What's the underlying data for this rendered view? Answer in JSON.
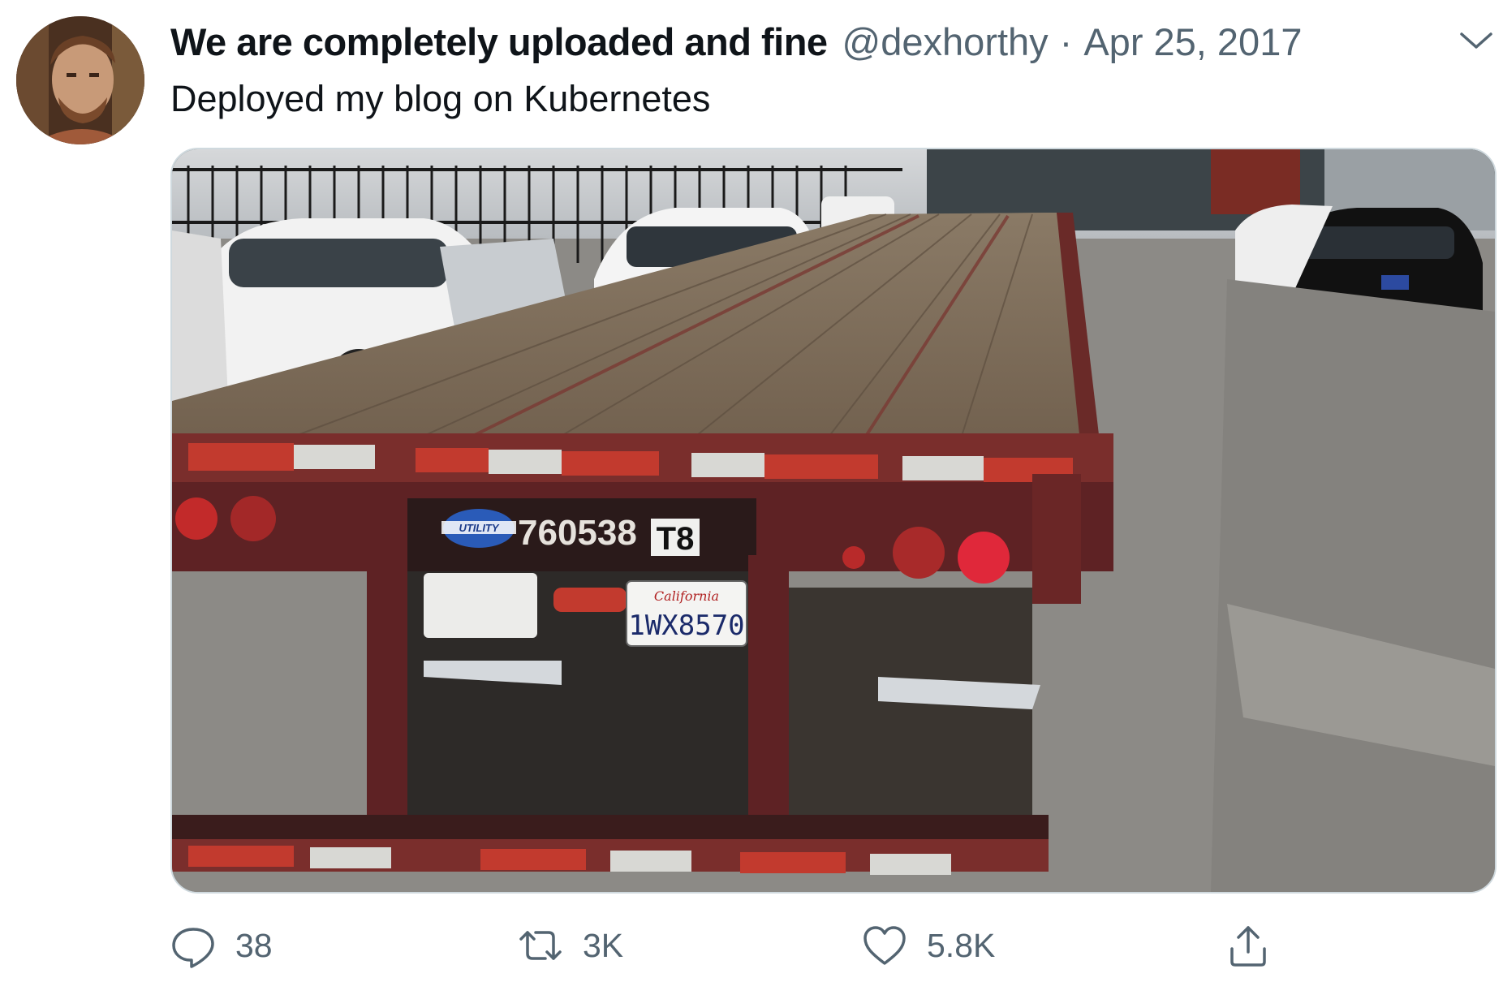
{
  "tweet": {
    "display_name": "We are completely uploaded and fine",
    "handle": "@dexhorthy",
    "separator": "·",
    "date": "Apr 25, 2017",
    "text": "Deployed my blog on Kubernetes"
  },
  "media": {
    "trailer_number": "760538",
    "trailer_code": "T8",
    "logo_text": "UTILITY",
    "plate_state": "California",
    "plate_number": "1WX8570"
  },
  "actions": {
    "reply_count": "38",
    "retweet_count": "3K",
    "like_count": "5.8K"
  },
  "icons": {
    "menu": "chevron-down-icon",
    "reply": "reply-icon",
    "retweet": "retweet-icon",
    "like": "heart-icon",
    "share": "share-icon"
  },
  "colors": {
    "text_primary": "#0f1419",
    "text_secondary": "#536471",
    "border": "#cfd9de"
  }
}
